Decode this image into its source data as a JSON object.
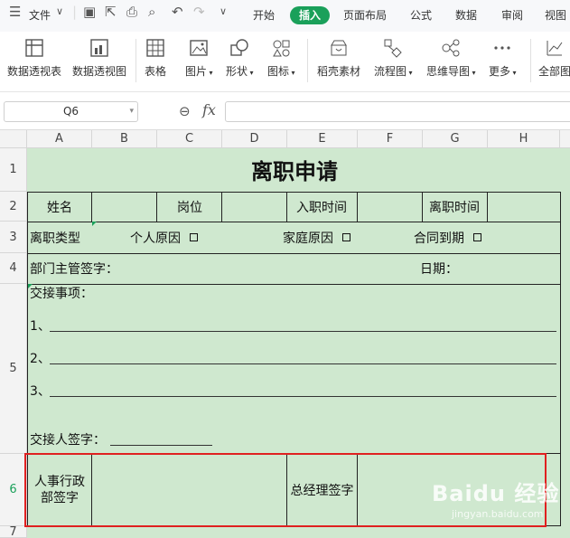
{
  "menu": {
    "file_label": "文件",
    "tabs": [
      "开始",
      "插入",
      "页面布局",
      "公式",
      "数据",
      "审阅",
      "视图"
    ],
    "active_tab": "插入"
  },
  "ribbon": {
    "items": [
      "数据透视表",
      "数据透视图",
      "表格",
      "图片",
      "形状",
      "图标",
      "稻壳素材",
      "流程图",
      "思维导图",
      "更多",
      "全部图"
    ]
  },
  "formula_bar": {
    "cell_ref": "Q6",
    "fx_label": "fx",
    "value": ""
  },
  "columns": [
    "A",
    "B",
    "C",
    "D",
    "E",
    "F",
    "G",
    "H"
  ],
  "rows": [
    "1",
    "2",
    "3",
    "4",
    "5",
    "6",
    "7"
  ],
  "sheet": {
    "title": "离职申请",
    "row2": {
      "name": "姓名",
      "position": "岗位",
      "join_date": "入职时间",
      "leave_date": "离职时间"
    },
    "row3": {
      "type": "离职类型",
      "personal": "个人原因",
      "family": "家庭原因",
      "contract": "合同到期"
    },
    "row4": {
      "supervisor_sign": "部门主管签字：",
      "date": "日期："
    },
    "row5": {
      "handover": "交接事项：",
      "item1": "1、",
      "item2": "2、",
      "item3": "3、",
      "handover_sign": "交接人签字："
    },
    "row6": {
      "hr_line1": "人事行政",
      "hr_line2": "部签字",
      "gm_sign": "总经理签字"
    }
  },
  "watermark": {
    "text": "Baidu 经验",
    "sub": "jingyan.baidu.com"
  },
  "colors": {
    "accent": "#1aa05a",
    "sheet_bg": "#cfe8cf",
    "highlight": "#e02020"
  }
}
